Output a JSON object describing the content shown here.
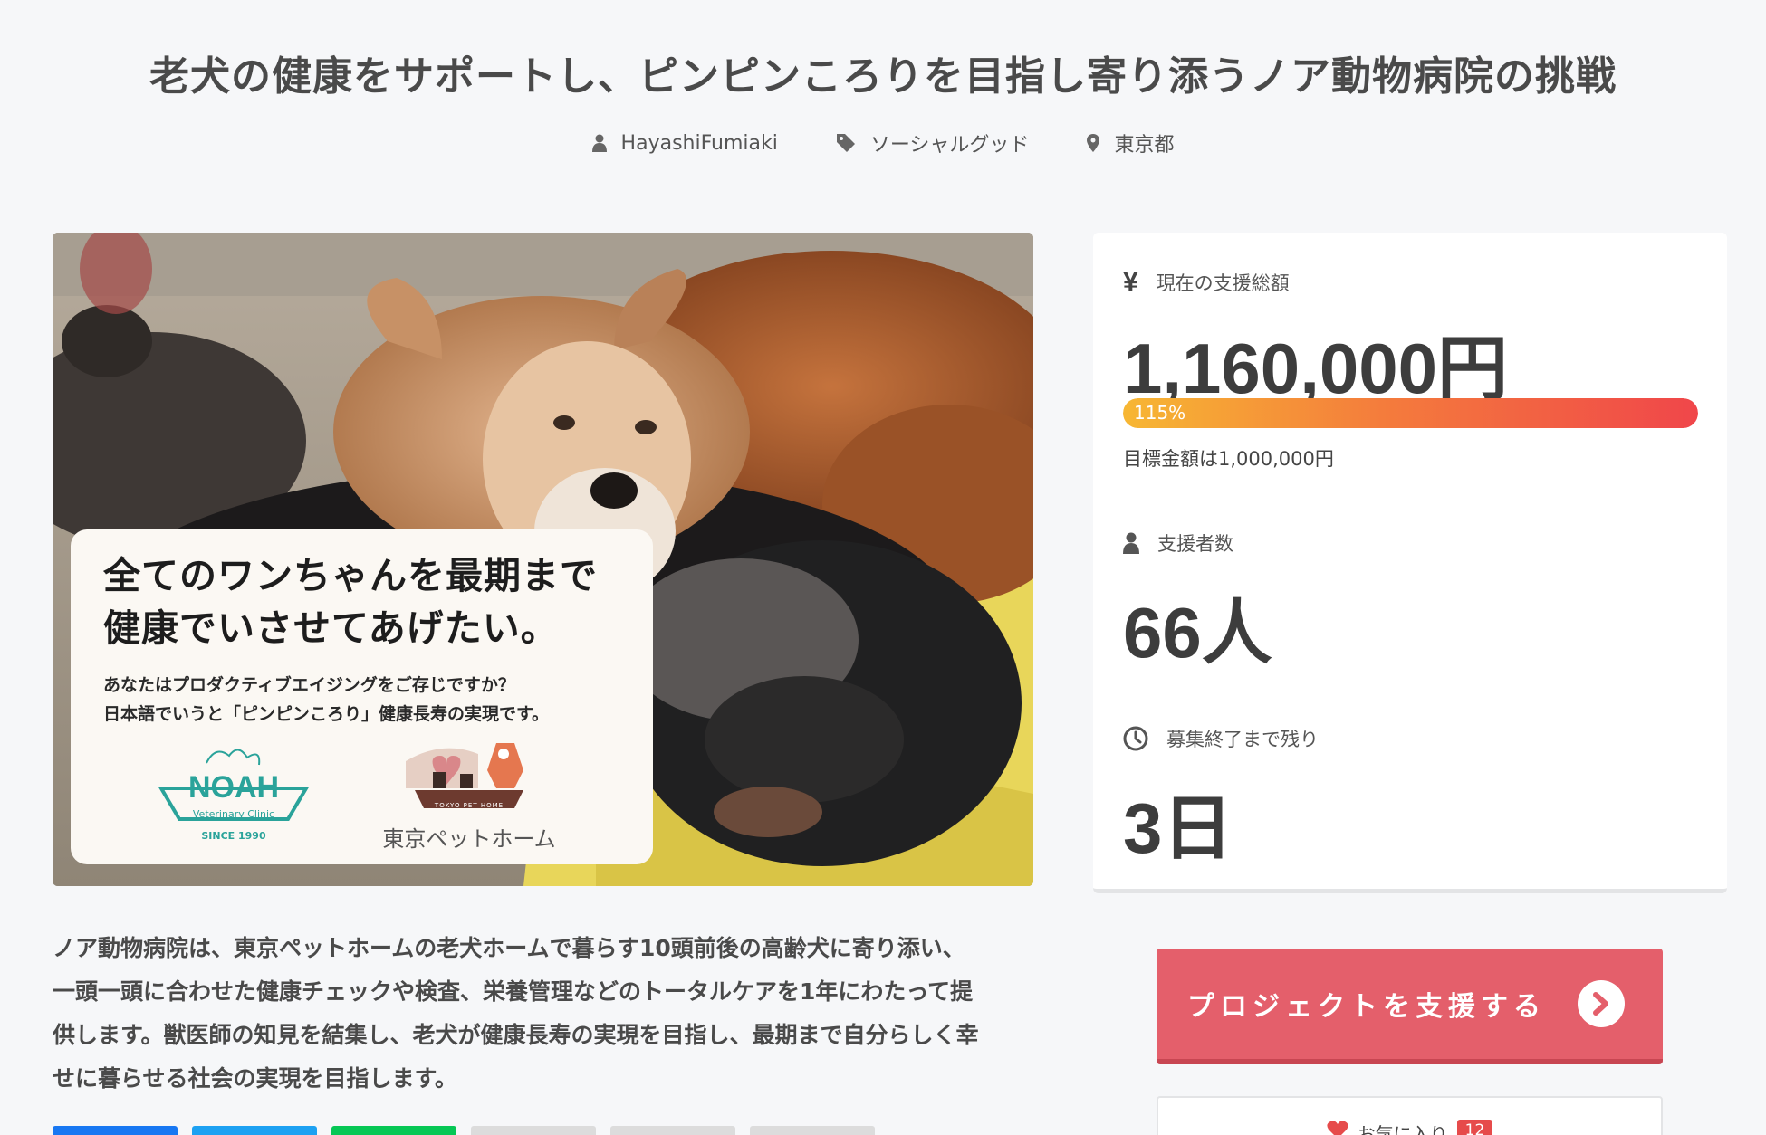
{
  "project": {
    "title": "老犬の健康をサポートし、ピンピンころりを目指し寄り添うノア動物病院の挑戦",
    "author": "HayashiFumiaki",
    "category": "ソーシャルグッド",
    "location": "東京都",
    "description_lines": [
      "ノア動物病院は、東京ペットホームの老犬ホームで暮らす10頭前後の高齢犬に寄り添い、",
      "一頭一頭に合わせた健康チェックや検査、栄養管理などのトータルケアを1年にわたって提",
      "供します。獣医師の知見を結集し、老犬が健康長寿の実現を目指し、最期まで自分らしく幸",
      "せに暮らせる社会の実現を目指します。"
    ]
  },
  "hero": {
    "headline_line1": "全てのワンちゃんを最期まで",
    "headline_line2": "健康でいさせてあげたい。",
    "sub_line1": "あなたはプロダクティブエイジングをご存じですか？",
    "sub_line2": "日本語でいうと「ピンピンころり」健康長寿の実現です。",
    "logo_noah": "NOAH",
    "logo_noah_sub": "Veterinary Clinic",
    "logo_noah_since": "SINCE 1990",
    "logo_pethome_tag": "TOKYO PET HOME",
    "logo_pethome": "東京ペットホーム"
  },
  "stats": {
    "amount_label": "現在の支援総額",
    "amount_value": "1,160,000円",
    "progress_percent": 115,
    "progress_text": "115%",
    "goal_text": "目標金額は1,000,000円",
    "backers_label": "支援者数",
    "backers_value": "66人",
    "remaining_label": "募集終了まで残り",
    "remaining_value": "3日"
  },
  "actions": {
    "support_label": "プロジェクトを支援する",
    "favorite_label": "お気に入り",
    "favorite_count": "12"
  },
  "colors": {
    "accent": "#e45f6b",
    "progress_start": "#f7b733",
    "progress_end": "#f0464a",
    "share_facebook": "#1877f2",
    "share_twitter": "#1da1f2",
    "share_line": "#06c755",
    "share_other": "#dcdcdc"
  },
  "icons": {
    "author": "user-icon",
    "category": "tag-icon",
    "location": "map-pin-icon",
    "amount": "yen-icon",
    "backers": "user-icon",
    "remaining": "clock-icon",
    "support": "chevron-right-circle-icon",
    "favorite": "heart-icon"
  }
}
